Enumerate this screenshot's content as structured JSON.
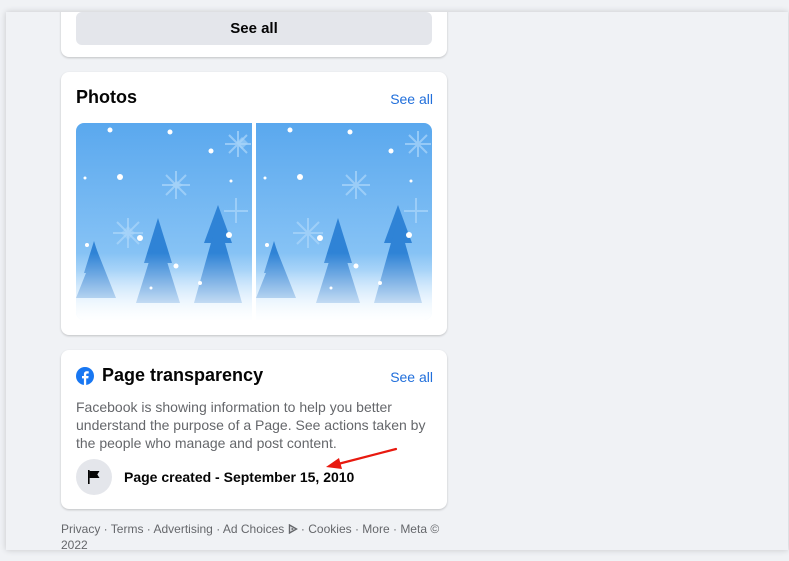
{
  "top_card": {
    "see_all_button": "See all"
  },
  "photos": {
    "title": "Photos",
    "see_all": "See all",
    "items": [
      {
        "icon": "winter-snow-trees-image"
      },
      {
        "icon": "winter-snow-trees-image"
      }
    ]
  },
  "transparency": {
    "title": "Page transparency",
    "see_all": "See all",
    "description": "Facebook is showing information to help you better understand the purpose of a Page. See actions taken by the people who manage and post content.",
    "created": "Page created - September 15, 2010",
    "icon": "facebook-icon",
    "flag_icon": "flag-icon"
  },
  "annotation": {
    "icon": "red-arrow",
    "color": "#e8190f"
  },
  "footer": {
    "privacy": "Privacy",
    "terms": "Terms",
    "advertising": "Advertising",
    "ad_choices": "Ad Choices",
    "cookies": "Cookies",
    "more": "More",
    "meta": "Meta © 2022",
    "separator": " · "
  },
  "colors": {
    "background": "#f0f2f5",
    "card": "#ffffff",
    "link": "#216fdb",
    "secondary_text": "#65676b",
    "button": "#e4e6eb",
    "facebook_blue": "#1877f2"
  }
}
